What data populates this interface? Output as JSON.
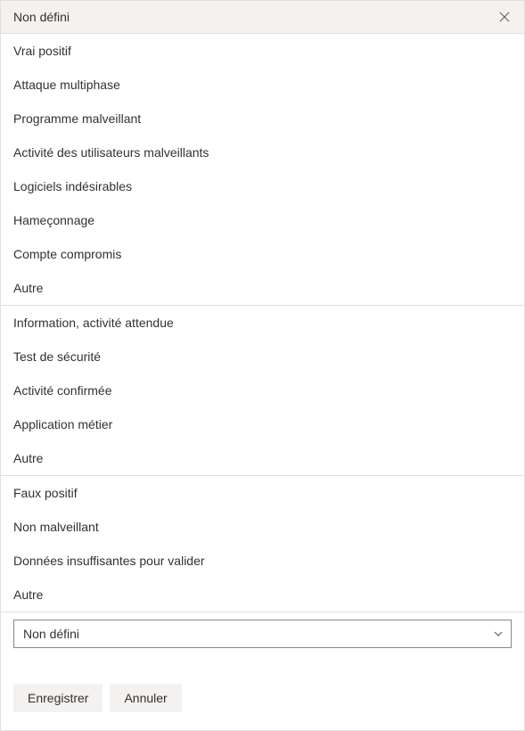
{
  "header": {
    "title": "Non défini"
  },
  "groups": [
    {
      "name": "true-positive",
      "items": [
        "Vrai positif",
        "Attaque multiphase",
        "Programme malveillant",
        "Activité des utilisateurs malveillants",
        "Logiciels indésirables",
        "Hameçonnage",
        "Compte compromis",
        "Autre"
      ]
    },
    {
      "name": "informational",
      "items": [
        "Information, activité attendue",
        "Test de sécurité",
        "Activité confirmée",
        "Application métier",
        "Autre"
      ]
    },
    {
      "name": "false-positive",
      "items": [
        "Faux positif",
        "Non malveillant",
        "Données insuffisantes pour valider",
        "Autre"
      ]
    }
  ],
  "dropdown": {
    "selected": "Non défini"
  },
  "footer": {
    "save": "Enregistrer",
    "cancel": "Annuler"
  }
}
